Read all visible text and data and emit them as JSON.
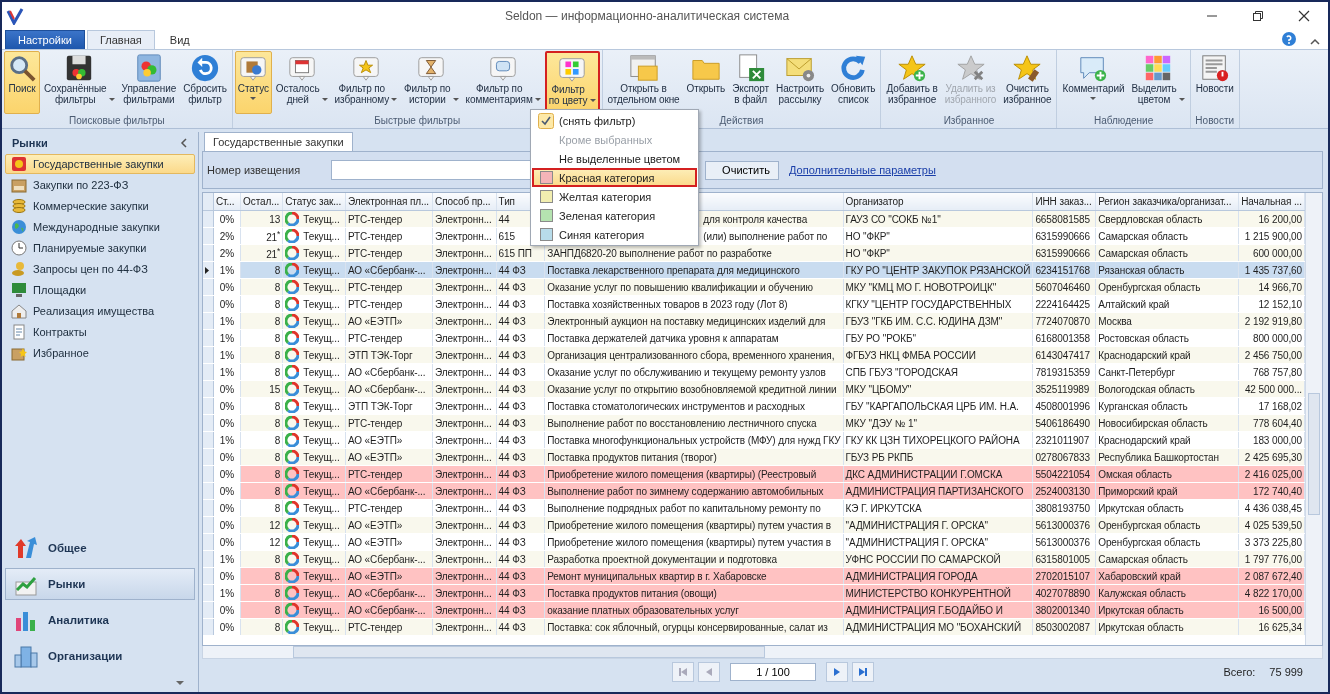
{
  "window": {
    "title": "Seldon — информационно-аналитическая система"
  },
  "ribbon_tabs": [
    {
      "label": "Настройки",
      "kind": "app",
      "selected": false
    },
    {
      "label": "Главная",
      "kind": "tab",
      "selected": true
    },
    {
      "label": "Вид",
      "kind": "tab",
      "selected": false
    }
  ],
  "ribbon": [
    {
      "label": "Поисковые фильтры",
      "buttons": [
        {
          "label": "Поиск",
          "active": true,
          "dropdown": false,
          "disabled": false
        },
        {
          "label": "Сохранённые\nфильтры",
          "active": false,
          "dropdown": true,
          "disabled": false
        },
        {
          "label": "Управление\nфильтрами",
          "active": false,
          "dropdown": false,
          "disabled": false
        },
        {
          "label": "Сбросить\nфильтр",
          "active": false,
          "dropdown": false,
          "disabled": false
        }
      ]
    },
    {
      "label": "Быстрые фильтры",
      "buttons": [
        {
          "label": "Статус",
          "active": true,
          "dropdown": true,
          "disabled": false
        },
        {
          "label": "Осталось\nдней",
          "active": false,
          "dropdown": true,
          "disabled": false
        },
        {
          "label": "Фильтр по\nизбранному",
          "active": false,
          "dropdown": true,
          "disabled": false
        },
        {
          "label": "Фильтр по\nистории",
          "active": false,
          "dropdown": true,
          "disabled": false
        },
        {
          "label": "Фильтр по\nкомментариям",
          "active": false,
          "dropdown": true,
          "disabled": false
        },
        {
          "label": "Фильтр\nпо цвету",
          "active": true,
          "dropdown": true,
          "disabled": false,
          "open": true
        }
      ]
    },
    {
      "label": "Действия",
      "buttons": [
        {
          "label": "Открыть в\nотдельном окне",
          "active": false,
          "dropdown": false,
          "disabled": false
        },
        {
          "label": "Открыть",
          "active": false,
          "dropdown": false,
          "disabled": false
        },
        {
          "label": "Экспорт\nв файл",
          "active": false,
          "dropdown": false,
          "disabled": false
        },
        {
          "label": "Настроить\nрассылку",
          "active": false,
          "dropdown": false,
          "disabled": false
        },
        {
          "label": "Обновить\nсписок",
          "active": false,
          "dropdown": false,
          "disabled": false
        }
      ]
    },
    {
      "label": "Избранное",
      "buttons": [
        {
          "label": "Добавить в\nизбранное",
          "active": false,
          "dropdown": false,
          "disabled": false
        },
        {
          "label": "Удалить из\nизбранного",
          "active": false,
          "dropdown": false,
          "disabled": true
        },
        {
          "label": "Очистить\nизбранное",
          "active": false,
          "dropdown": false,
          "disabled": false
        }
      ]
    },
    {
      "label": "Наблюдение",
      "buttons": [
        {
          "label": "Комментарий",
          "active": false,
          "dropdown": true,
          "disabled": false
        },
        {
          "label": "Выделить\nцветом",
          "active": false,
          "dropdown": true,
          "disabled": false
        }
      ]
    },
    {
      "label": "Новости",
      "buttons": [
        {
          "label": "Новости",
          "active": false,
          "dropdown": false,
          "disabled": false
        }
      ]
    }
  ],
  "color_menu": [
    {
      "label": "(снять фильтр)",
      "kind": "check",
      "checked": true,
      "disabled": false,
      "selected": false
    },
    {
      "label": "Кроме выбранных",
      "kind": "plain",
      "disabled": true,
      "selected": false
    },
    {
      "label": "Не выделенные цветом",
      "kind": "plain",
      "disabled": false,
      "selected": false
    },
    {
      "label": "Красная категория",
      "kind": "swatch",
      "color": "#f4b4b8",
      "disabled": false,
      "selected": true
    },
    {
      "label": "Желтая категория",
      "kind": "swatch",
      "color": "#f2eeb0",
      "disabled": false,
      "selected": false
    },
    {
      "label": "Зеленая категория",
      "kind": "swatch",
      "color": "#b5e3b0",
      "disabled": false,
      "selected": false
    },
    {
      "label": "Синяя категория",
      "kind": "swatch",
      "color": "#b8dcea",
      "disabled": false,
      "selected": false
    }
  ],
  "sidebar": {
    "title": "Рынки",
    "items": [
      {
        "label": "Государственные закупки",
        "selected": true
      },
      {
        "label": "Закупки по 223-ФЗ",
        "selected": false
      },
      {
        "label": "Коммерческие закупки",
        "selected": false
      },
      {
        "label": "Международные закупки",
        "selected": false
      },
      {
        "label": "Планируемые закупки",
        "selected": false
      },
      {
        "label": "Запросы цен по 44-ФЗ",
        "selected": false
      },
      {
        "label": "Площадки",
        "selected": false
      },
      {
        "label": "Реализация имущества",
        "selected": false
      },
      {
        "label": "Контракты",
        "selected": false
      },
      {
        "label": "Избранное",
        "selected": false
      }
    ],
    "sections": [
      {
        "label": "Общее",
        "selected": false
      },
      {
        "label": "Рынки",
        "selected": true
      },
      {
        "label": "Аналитика",
        "selected": false
      },
      {
        "label": "Организации",
        "selected": false
      }
    ]
  },
  "document_tab": {
    "label": "Государственные закупки"
  },
  "filter": {
    "label": "Номер извещения",
    "clear_button": "Очистить",
    "link": "Дополнительные параметры"
  },
  "table": {
    "columns": [
      "Ст...",
      "Остал...",
      "Статус зак...",
      "Электронная пл...",
      "Способ пр...",
      "Тип",
      "",
      "Организатор",
      "ИНН заказ...",
      "Регион заказчика/организат...",
      "Начальная ..."
    ],
    "rows": [
      {
        "selected": false,
        "covered": true,
        "cells": [
          "0%",
          "13",
          "Текущ...",
          "РТС-тендер",
          "Электронн...",
          "44",
          "для контроля качества",
          "ГАУЗ СО \"СОКБ №1\"",
          "6658081585",
          "Свердловская область",
          "16 200,00"
        ]
      },
      {
        "selected": false,
        "covered": true,
        "cells": [
          "2%",
          "21$^{*}$",
          "Текущ...",
          "РТС-тендер",
          "Электронн...",
          "615",
          "(или) выполнение работ по",
          "НО \"ФКР\"",
          "6315990666",
          "Самарская область",
          "1 215 900,00"
        ]
      },
      {
        "selected": false,
        "cells": [
          "2%",
          "21$^{*}$",
          "Текущ...",
          "РТС-тендер",
          "Электронн...",
          "615 ПП",
          "ЗАНПД6820-20 выполнение работ по разработке",
          "НО \"ФКР\"",
          "6315990666",
          "Самарская область",
          "600 000,00"
        ]
      },
      {
        "selected": true,
        "cells": [
          "1%",
          "8",
          "Текущ...",
          "АО «Сбербанк-...",
          "Электронн...",
          "44 ФЗ",
          "Поставка лекарственного препарата для медицинского",
          "ГКУ РО \"ЦЕНТР ЗАКУПОК РЯЗАНСКОЙ",
          "6234151768",
          "Рязанская область",
          "1 435 737,60"
        ]
      },
      {
        "selected": false,
        "cells": [
          "0%",
          "8",
          "Текущ...",
          "РТС-тендер",
          "Электронн...",
          "44 ФЗ",
          "Оказание услуг по повышению квалификации и обучению",
          "МКУ \"КМЦ МО Г. НОВОТРОИЦК\"",
          "5607046460",
          "Оренбургская область",
          "14 966,70"
        ]
      },
      {
        "selected": false,
        "cells": [
          "0%",
          "8",
          "Текущ...",
          "РТС-тендер",
          "Электронн...",
          "44 ФЗ",
          "Поставка хозяйственных товаров в 2023 году (Лот 8)",
          "КГКУ \"ЦЕНТР ГОСУДАРСТВЕННЫХ",
          "2224164425",
          "Алтайский край",
          "12 152,10"
        ]
      },
      {
        "selected": false,
        "cells": [
          "1%",
          "8",
          "Текущ...",
          "АО «ЕЭТП»",
          "Электронн...",
          "44 ФЗ",
          "Электронный аукцион на поставку медицинских изделий для",
          "ГБУЗ \"ГКБ ИМ. С.С. ЮДИНА ДЗМ\"",
          "7724070870",
          "Москва",
          "2 192 919,80"
        ]
      },
      {
        "selected": false,
        "cells": [
          "1%",
          "8",
          "Текущ...",
          "РТС-тендер",
          "Электронн...",
          "44 ФЗ",
          "Поставка держателей датчика уровня к аппаратам",
          "ГБУ РО \"РОКБ\"",
          "6168001358",
          "Ростовская область",
          "800 000,00"
        ]
      },
      {
        "selected": false,
        "cells": [
          "1%",
          "8",
          "Текущ...",
          "ЭТП ТЭК-Торг",
          "Электронн...",
          "44 ФЗ",
          "Организация централизованного сбора, временного хранения,",
          "ФГБУЗ  НКЦ ФМБА РОССИИ",
          "6143047417",
          "Краснодарский край",
          "2 456 750,00"
        ]
      },
      {
        "selected": false,
        "cells": [
          "1%",
          "8",
          "Текущ...",
          "АО «Сбербанк-...",
          "Электронн...",
          "44 ФЗ",
          "Оказание услуг по обслуживанию и текущему ремонту узлов",
          "СПБ ГБУЗ \"ГОРОДСКАЯ",
          "7819315359",
          "Санкт-Петербург",
          "768 757,80"
        ]
      },
      {
        "selected": false,
        "cells": [
          "0%",
          "15",
          "Текущ...",
          "АО «Сбербанк-...",
          "Электронн...",
          "44 ФЗ",
          "Оказание услуг по открытию возобновляемой кредитной линии",
          "МКУ \"ЦБОМУ\"",
          "3525119989",
          "Вологодская область",
          "42 500 000..."
        ]
      },
      {
        "selected": false,
        "cells": [
          "0%",
          "8",
          "Текущ...",
          "ЭТП ТЭК-Торг",
          "Электронн...",
          "44 ФЗ",
          "Поставка стоматологических инструментов и расходных",
          "ГБУ \"КАРГАПОЛЬСКАЯ ЦРБ ИМ. Н.А.",
          "4508001996",
          "Курганская область",
          "17 168,02"
        ]
      },
      {
        "selected": false,
        "cells": [
          "0%",
          "8",
          "Текущ...",
          "РТС-тендер",
          "Электронн...",
          "44 ФЗ",
          "Выполнение работ по восстановлению лестничного спуска",
          "МКУ \"ДЭУ № 1\"",
          "5406186490",
          "Новосибирская область",
          "778 604,40"
        ]
      },
      {
        "selected": false,
        "cells": [
          "1%",
          "8",
          "Текущ...",
          "АО «ЕЭТП»",
          "Электронн...",
          "44 ФЗ",
          "Поставка многофункциональных устройств (МФУ) для нужд ГКУ",
          "ГКУ КК ЦЗН ТИХОРЕЦКОГО РАЙОНА",
          "2321011907",
          "Краснодарский край",
          "183 000,00"
        ]
      },
      {
        "selected": false,
        "cells": [
          "0%",
          "8",
          "Текущ...",
          "АО «ЕЭТП»",
          "Электронн...",
          "44 ФЗ",
          "Поставка продуктов питания (творог)",
          "ГБУЗ РБ РКПБ",
          "0278067833",
          "Республика Башкортостан",
          "2 425 695,30"
        ]
      },
      {
        "selected": false,
        "color": "#ffc2c2",
        "cells": [
          "0%",
          "8",
          "Текущ...",
          "РТС-тендер",
          "Электронн...",
          "44 ФЗ",
          "Приобретение жилого помещения (квартиры) (Реестровый",
          "ДКС АДМИНИСТРАЦИИ Г.ОМСКА",
          "5504221054",
          "Омская область",
          "2 416 025,00"
        ]
      },
      {
        "selected": false,
        "color": "#ffc2c2",
        "cells": [
          "0%",
          "8",
          "Текущ...",
          "АО «Сбербанк-...",
          "Электронн...",
          "44 ФЗ",
          "Выполнение работ по зимнему содержанию автомобильных",
          "АДМИНИСТРАЦИЯ ПАРТИЗАНСКОГО",
          "2524003130",
          "Приморский край",
          "172 740,40"
        ]
      },
      {
        "selected": false,
        "cells": [
          "0%",
          "8",
          "Текущ...",
          "РТС-тендер",
          "Электронн...",
          "44 ФЗ",
          "Выполнение подрядных работ по капитальному ремонту по",
          "КЭ Г. ИРКУТСКА",
          "3808193750",
          "Иркутская область",
          "4 436 038,45"
        ]
      },
      {
        "selected": false,
        "cells": [
          "0%",
          "12",
          "Текущ...",
          "АО «ЕЭТП»",
          "Электронн...",
          "44 ФЗ",
          "Приобретение жилого помещения (квартиры) путем участия в",
          "\"АДМИНИСТРАЦИЯ Г. ОРСКА\"",
          "5613000376",
          "Оренбургская область",
          "4 025 539,50"
        ]
      },
      {
        "selected": false,
        "cells": [
          "0%",
          "12",
          "Текущ...",
          "АО «ЕЭТП»",
          "Электронн...",
          "44 ФЗ",
          "Приобретение жилого помещения (квартиры) путем участия в",
          "\"АДМИНИСТРАЦИЯ Г. ОРСКА\"",
          "5613000376",
          "Оренбургская область",
          "3 373 225,80"
        ]
      },
      {
        "selected": false,
        "cells": [
          "1%",
          "8",
          "Текущ...",
          "АО «Сбербанк-...",
          "Электронн...",
          "44 ФЗ",
          "Разработка проектной документации и подготовка",
          "УФНС РОССИИ ПО САМАРСКОЙ",
          "6315801005",
          "Самарская область",
          "1 797 776,00"
        ]
      },
      {
        "selected": false,
        "color": "#ffc2c2",
        "cells": [
          "0%",
          "8",
          "Текущ...",
          "АО «ЕЭТП»",
          "Электронн...",
          "44 ФЗ",
          "Ремонт муниципальных квартир в г. Хабаровске",
          "АДМИНИСТРАЦИЯ ГОРОДА",
          "2702015107",
          "Хабаровский край",
          "2 087 672,40"
        ]
      },
      {
        "selected": false,
        "color": "#ffc2c2",
        "cells": [
          "1%",
          "8",
          "Текущ...",
          "АО «Сбербанк-...",
          "Электронн...",
          "44 ФЗ",
          "Поставка продуктов питания (овощи)",
          "МИНИСТЕРСТВО КОНКУРЕНТНОЙ",
          "4027078890",
          "Калужская область",
          "4 822 170,00"
        ]
      },
      {
        "selected": false,
        "color": "#ffc2c2",
        "cells": [
          "0%",
          "8",
          "Текущ...",
          "АО «Сбербанк-...",
          "Электронн...",
          "44 ФЗ",
          "оказание платных образовательных услуг",
          "АДМИНИСТРАЦИЯ Г.БОДАЙБО И",
          "3802001340",
          "Иркутская область",
          "16 500,00"
        ]
      },
      {
        "selected": false,
        "cells": [
          "0%",
          "8",
          "Текущ...",
          "РТС-тендер",
          "Электронн...",
          "44 ФЗ",
          "Поставка: сок яблочный, огурцы консервированные, салат из",
          "АДМИНИСТРАЦИЯ МО \"БОХАНСКИЙ",
          "8503002087",
          "Иркутская область",
          "16 625,34"
        ]
      }
    ]
  },
  "pager": {
    "page": "1 / 100",
    "total_label": "Всего:",
    "total": "75 999"
  }
}
